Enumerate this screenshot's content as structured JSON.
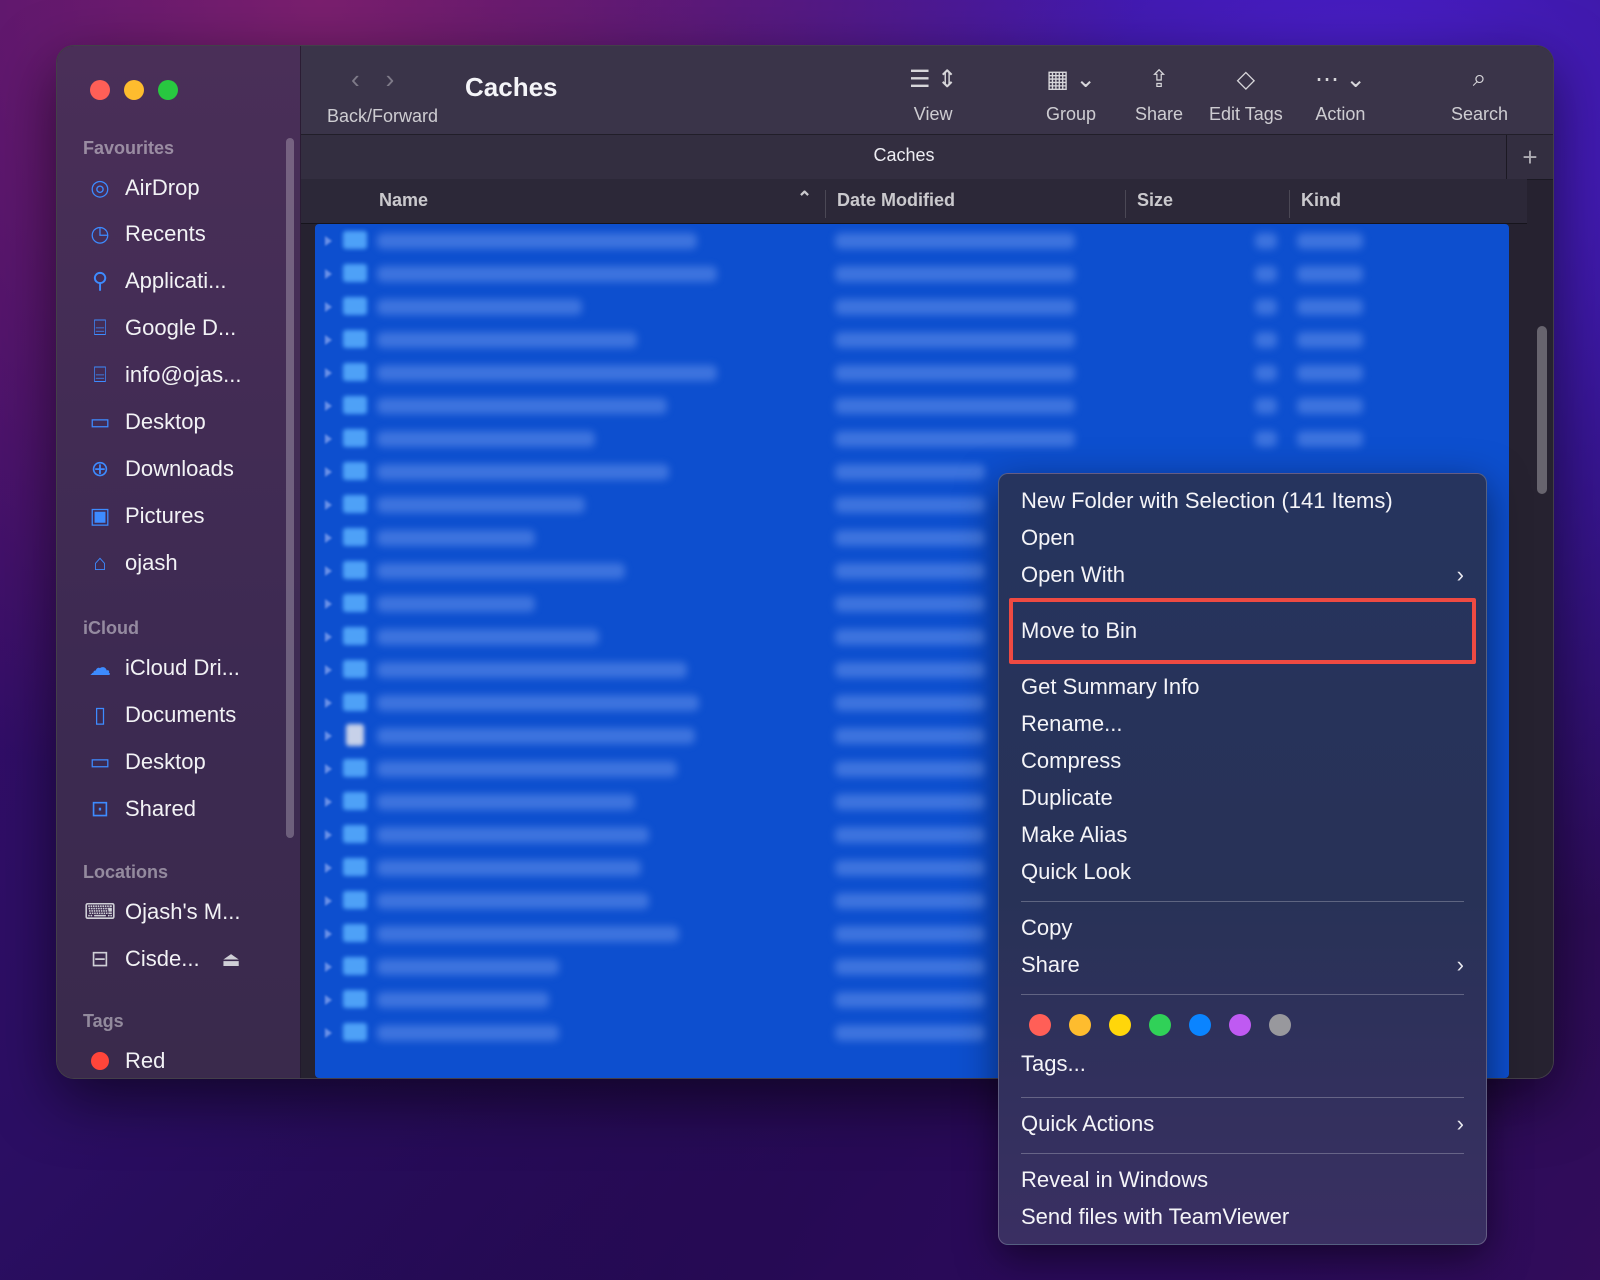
{
  "window": {
    "title": "Caches",
    "tab_title": "Caches"
  },
  "toolbar": {
    "back_forward": "Back/Forward",
    "view": "View",
    "group": "Group",
    "share": "Share",
    "edit_tags": "Edit Tags",
    "action": "Action",
    "search": "Search"
  },
  "sidebar": {
    "favourites_header": "Favourites",
    "favourites": [
      {
        "label": "AirDrop",
        "icon": "airdrop-icon"
      },
      {
        "label": "Recents",
        "icon": "clock-icon"
      },
      {
        "label": "Applicati...",
        "icon": "applications-icon"
      },
      {
        "label": "Google D...",
        "icon": "network-drive-icon"
      },
      {
        "label": "info@ojas...",
        "icon": "network-drive-icon"
      },
      {
        "label": "Desktop",
        "icon": "desktop-icon"
      },
      {
        "label": "Downloads",
        "icon": "downloads-icon"
      },
      {
        "label": "Pictures",
        "icon": "pictures-icon"
      },
      {
        "label": "ojash",
        "icon": "home-icon"
      }
    ],
    "icloud_header": "iCloud",
    "icloud": [
      {
        "label": "iCloud Dri...",
        "icon": "cloud-icon"
      },
      {
        "label": "Documents",
        "icon": "document-icon"
      },
      {
        "label": "Desktop",
        "icon": "desktop-icon"
      },
      {
        "label": "Shared",
        "icon": "shared-folder-icon"
      }
    ],
    "locations_header": "Locations",
    "locations": [
      {
        "label": "Ojash's M...",
        "icon": "laptop-icon"
      },
      {
        "label": "Cisde...",
        "icon": "external-drive-icon"
      }
    ],
    "tags_header": "Tags",
    "tags": [
      {
        "label": "Red",
        "color": "#ff453a"
      }
    ]
  },
  "columns": {
    "name": "Name",
    "date": "Date Modified",
    "size": "Size",
    "kind": "Kind"
  },
  "context_menu": {
    "new_folder": "New Folder with Selection (141 Items)",
    "open": "Open",
    "open_with": "Open With",
    "move_to_bin": "Move to Bin",
    "get_summary": "Get Summary Info",
    "rename": "Rename...",
    "compress": "Compress",
    "duplicate": "Duplicate",
    "make_alias": "Make Alias",
    "quick_look": "Quick Look",
    "copy": "Copy",
    "share": "Share",
    "tag_colors": [
      "#ff5f57",
      "#febc2e",
      "#ffd60a",
      "#30d158",
      "#0a84ff",
      "#bf5af2",
      "#98989d"
    ],
    "tags": "Tags...",
    "quick_actions": "Quick Actions",
    "reveal": "Reveal in Windows",
    "teamviewer": "Send files with TeamViewer"
  },
  "colors": {
    "selection": "#0d4fcf",
    "highlight_box": "#ee4a42"
  }
}
